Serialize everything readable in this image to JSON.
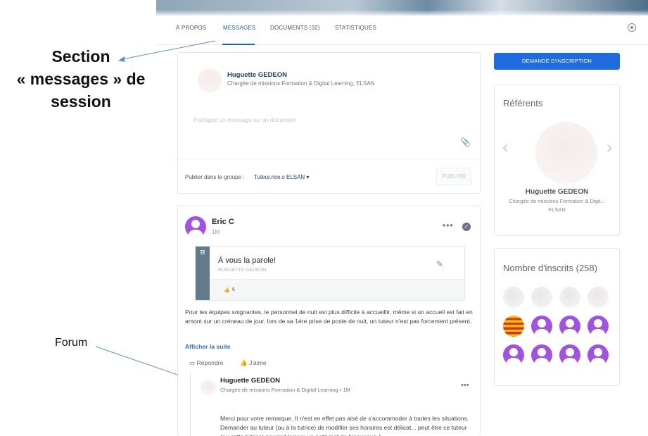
{
  "tabs": [
    {
      "label": "À PROPOS"
    },
    {
      "label": "MESSAGES"
    },
    {
      "label": "DOCUMENTS (32)"
    },
    {
      "label": "STATISTIQUES"
    }
  ],
  "annotations": {
    "section_line1": "Section",
    "section_line2": "« messages » de",
    "section_line3": "session",
    "forum": "Forum"
  },
  "composer": {
    "author_name": "Huguette GEDEON",
    "author_role": "Chargée de missions Formation & Digital Learning, ELSAN",
    "placeholder": "Partagez un message ou un document",
    "publish_label": "Publier dans le groupe :",
    "group": "Tuteur.rice.s ELSAN ▾",
    "publish_button": "PUBLIER"
  },
  "post": {
    "author": "Eric C",
    "time": "1M",
    "dots": "•••",
    "embed": {
      "title": "À vous la parole!",
      "subtitle": "HUGUETTE GEDEON",
      "likes": "6"
    },
    "body": "Pour les équipes soignantes, le personnel de nuit est plus difficile à accueillir, même si un accueil  est fait en amont sur un créneau de jour. lors de sa 1ére prise de poste de nuit, un tuteur n'est pas forcement présent.",
    "show_more": "Afficher la suite",
    "reply_action": "Répondre",
    "like_action": "J'aime",
    "reply": {
      "author": "Huguette GEDEON",
      "role": "Chargée de missions Formation & Digital Learning  •  1M",
      "dots": "•••",
      "body": "Merci pour votre remarque. Il n'est en effet pas aisé de s'accommoder à toutes les situations. Demander au tuteur (ou à la tutrice) de modifier ses horaires est délicat... peut être ce tuteur (ou cette tutrice) pourrait laisser un petit mot de bienvenue à"
    }
  },
  "sidebar": {
    "cta": "DEMANDE D'INSCRIPTION",
    "referents": {
      "title": "Référents",
      "name": "Huguette GEDEON",
      "role": "Chargée de missions Formation & Digit...",
      "org": "ELSAN"
    },
    "inscrits": {
      "title": "Nombre d'inscrits  (258)"
    }
  },
  "colors": {
    "accent": "#1f6be0",
    "user_icon": "#a252e0",
    "embed_bar": "#627a8a"
  }
}
